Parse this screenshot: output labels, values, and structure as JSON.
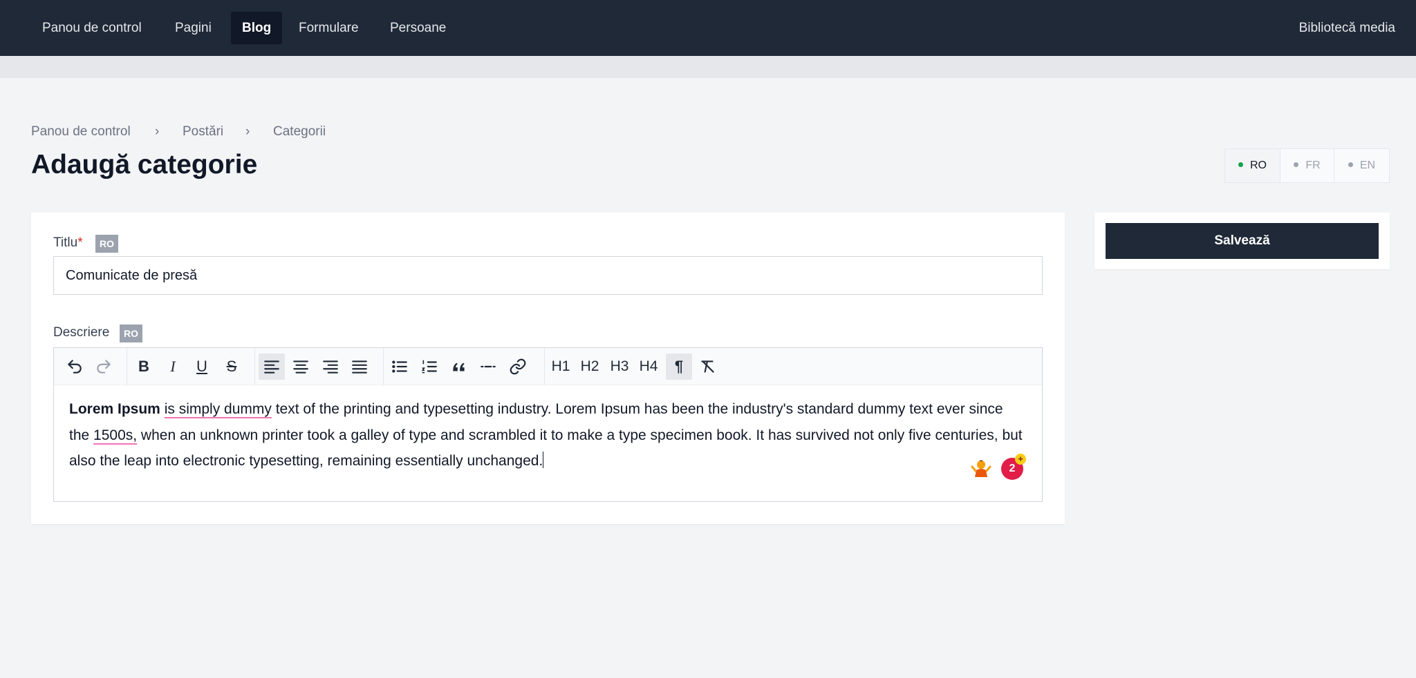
{
  "nav": {
    "items": [
      {
        "label": "Panou de control"
      },
      {
        "label": "Pagini"
      },
      {
        "label": "Blog"
      },
      {
        "label": "Formulare"
      },
      {
        "label": "Persoane"
      }
    ],
    "active": "Blog",
    "media_label": "Bibliotecă media"
  },
  "breadcrumb": {
    "items": [
      "Panou de control",
      "Postări",
      "Categorii"
    ],
    "separator": "›"
  },
  "page": {
    "title": "Adaugă categorie"
  },
  "languages": {
    "items": [
      {
        "code": "RO"
      },
      {
        "code": "FR"
      },
      {
        "code": "EN"
      }
    ],
    "active": "RO"
  },
  "form": {
    "title_field": {
      "label": "Titlu",
      "required_mark": "*",
      "lang_badge": "RO",
      "value": "Comunicate de presă"
    },
    "description_field": {
      "label": "Descriere",
      "lang_badge": "RO",
      "content": {
        "bold": "Lorem Ipsum",
        "space1": " ",
        "spell1": "is simply dummy",
        "mid": " text of the printing and typesetting industry. Lorem Ipsum has been the industry's standard dummy text ever since the ",
        "spell2": "1500s,",
        "tail": " when an unknown printer took a galley of type and scrambled it to make a type specimen book. It has survived not only five centuries, but also the leap into electronic typesetting, remaining essentially unchanged."
      }
    }
  },
  "toolbar": {
    "undo_icon": "undo-icon",
    "redo_icon": "redo-icon",
    "bold": "B",
    "italic": "I",
    "underline": "U",
    "strike": "S",
    "h1": "H1",
    "h2": "H2",
    "h3": "H3",
    "h4": "H4",
    "paragraph": "¶"
  },
  "grammar_badge": {
    "count": "2",
    "plus": "+"
  },
  "actions": {
    "save_label": "Salvează"
  },
  "colors": {
    "nav_bg": "#1f2937",
    "active_dot": "#16a34a",
    "required": "#dc2626",
    "badge": "#e11d48"
  }
}
